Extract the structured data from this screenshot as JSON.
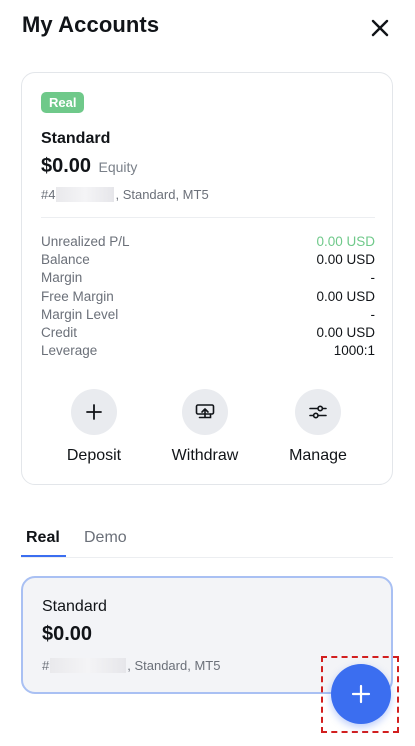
{
  "header": {
    "title": "My Accounts",
    "close_icon": "close-icon"
  },
  "account_card": {
    "badge": "Real",
    "name": "Standard",
    "equity_value": "$0.00",
    "equity_label": "Equity",
    "meta_prefix": "#4",
    "meta_suffix": ", Standard, MT5",
    "stats": [
      {
        "label": "Unrealized P/L",
        "value": "0.00 USD"
      },
      {
        "label": "Balance",
        "value": "0.00 USD"
      },
      {
        "label": "Margin",
        "value": "-"
      },
      {
        "label": "Free Margin",
        "value": "0.00 USD"
      },
      {
        "label": "Margin Level",
        "value": "-"
      },
      {
        "label": "Credit",
        "value": "0.00 USD"
      },
      {
        "label": "Leverage",
        "value": "1000:1"
      }
    ],
    "actions": [
      {
        "label": "Deposit",
        "icon": "plus-icon"
      },
      {
        "label": "Withdraw",
        "icon": "withdraw-icon"
      },
      {
        "label": "Manage",
        "icon": "sliders-icon"
      }
    ]
  },
  "tabs": [
    {
      "label": "Real"
    },
    {
      "label": "Demo"
    }
  ],
  "account_list": [
    {
      "name": "Standard",
      "value": "$0.00",
      "meta_prefix": "#",
      "meta_suffix": ", Standard, MT5"
    }
  ],
  "fab": {
    "icon": "plus-icon"
  },
  "colors": {
    "accent": "#3b6ef0",
    "badge_green": "#6fc98a",
    "positive": "#6fc98a",
    "highlight": "#d21f1f"
  }
}
